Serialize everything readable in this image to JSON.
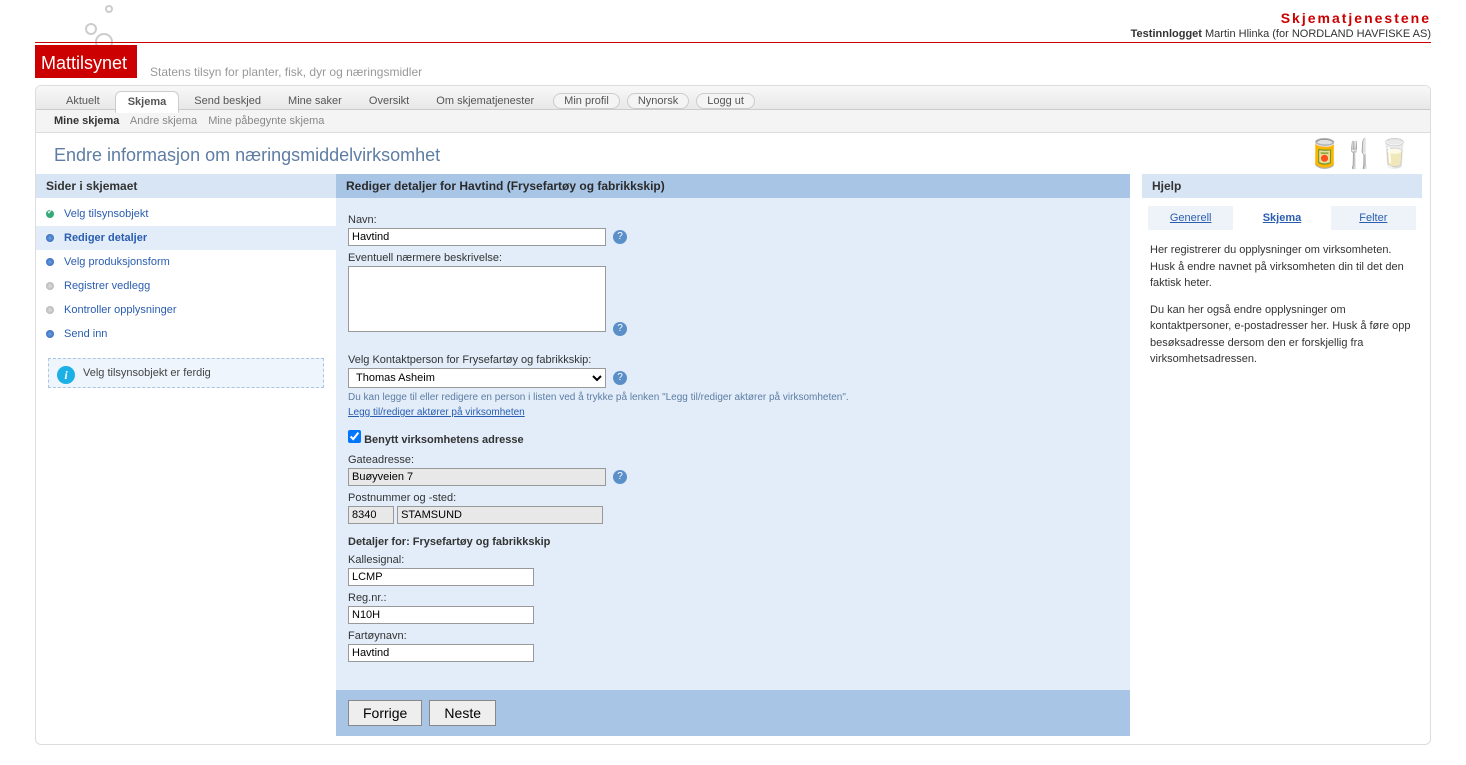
{
  "brand": {
    "service_title": "Skjematjenestene",
    "login_label": "Testinnlogget",
    "user_name": "Martin Hlinka",
    "org_prefix": "(for ",
    "org_name": "NORDLAND HAVFISKE AS",
    "org_suffix": ")",
    "logo_text": "Mattilsynet",
    "tagline": "Statens tilsyn for planter, fisk, dyr og næringsmidler"
  },
  "tabs": {
    "main": [
      "Aktuelt",
      "Skjema",
      "Send beskjed",
      "Mine saker",
      "Oversikt",
      "Om skjematjenester",
      "Min profil",
      "Nynorsk",
      "Logg ut"
    ],
    "main_active_index": 1,
    "sub": [
      "Mine skjema",
      "Andre skjema",
      "Mine påbegynte skjema"
    ],
    "sub_active_index": 0
  },
  "page": {
    "title": "Endre informasjon om næringsmiddelvirksomhet"
  },
  "sidebar": {
    "heading": "Sider i skjemaet",
    "items": [
      {
        "label": "Velg tilsynsobjekt",
        "state": "done"
      },
      {
        "label": "Rediger detaljer",
        "state": "active"
      },
      {
        "label": "Velg produksjonsform",
        "state": "todo-blue"
      },
      {
        "label": "Registrer vedlegg",
        "state": "todo-grey"
      },
      {
        "label": "Kontroller opplysninger",
        "state": "todo-grey"
      },
      {
        "label": "Send inn",
        "state": "todo-blue"
      }
    ],
    "info_msg": "Velg tilsynsobjekt er ferdig"
  },
  "form": {
    "heading": "Rediger detaljer for Havtind (Frysefartøy og fabrikkskip)",
    "name_label": "Navn:",
    "name_value": "Havtind",
    "desc_label": "Eventuell nærmere beskrivelse:",
    "desc_value": "",
    "contact_label": "Velg Kontaktperson for Frysefartøy og fabrikkskip:",
    "contact_selected": "Thomas Asheim",
    "contact_hint": "Du kan legge til eller redigere en person i listen ved å trykke på lenken \"Legg til/rediger aktører på virksomheten\".",
    "contact_link": "Legg til/rediger aktører på virksomheten",
    "use_address_label": "Benytt virksomhetens adresse",
    "use_address_checked": true,
    "street_label": "Gateadresse:",
    "street_value": "Buøyveien 7",
    "post_label": "Postnummer og -sted:",
    "post_nr": "8340",
    "post_place": "STAMSUND",
    "details_heading": "Detaljer for: Frysefartøy og fabrikkskip",
    "callsign_label": "Kallesignal:",
    "callsign_value": "LCMP",
    "regnr_label": "Reg.nr.:",
    "regnr_value": "N10H",
    "vesselname_label": "Fartøynavn:",
    "vesselname_value": "Havtind",
    "btn_prev": "Forrige",
    "btn_next": "Neste"
  },
  "help": {
    "heading": "Hjelp",
    "tabs": [
      "Generell",
      "Skjema",
      "Felter"
    ],
    "active_index": 1,
    "p1": "Her registrerer du opplysninger om virksomheten. Husk å endre navnet på virksomheten din til det den faktisk heter.",
    "p2": "Du kan her også endre opplysninger om kontaktpersoner, e-postadresser her. Husk å føre opp besøksadresse dersom den er forskjellig fra virksomhetsadressen."
  }
}
